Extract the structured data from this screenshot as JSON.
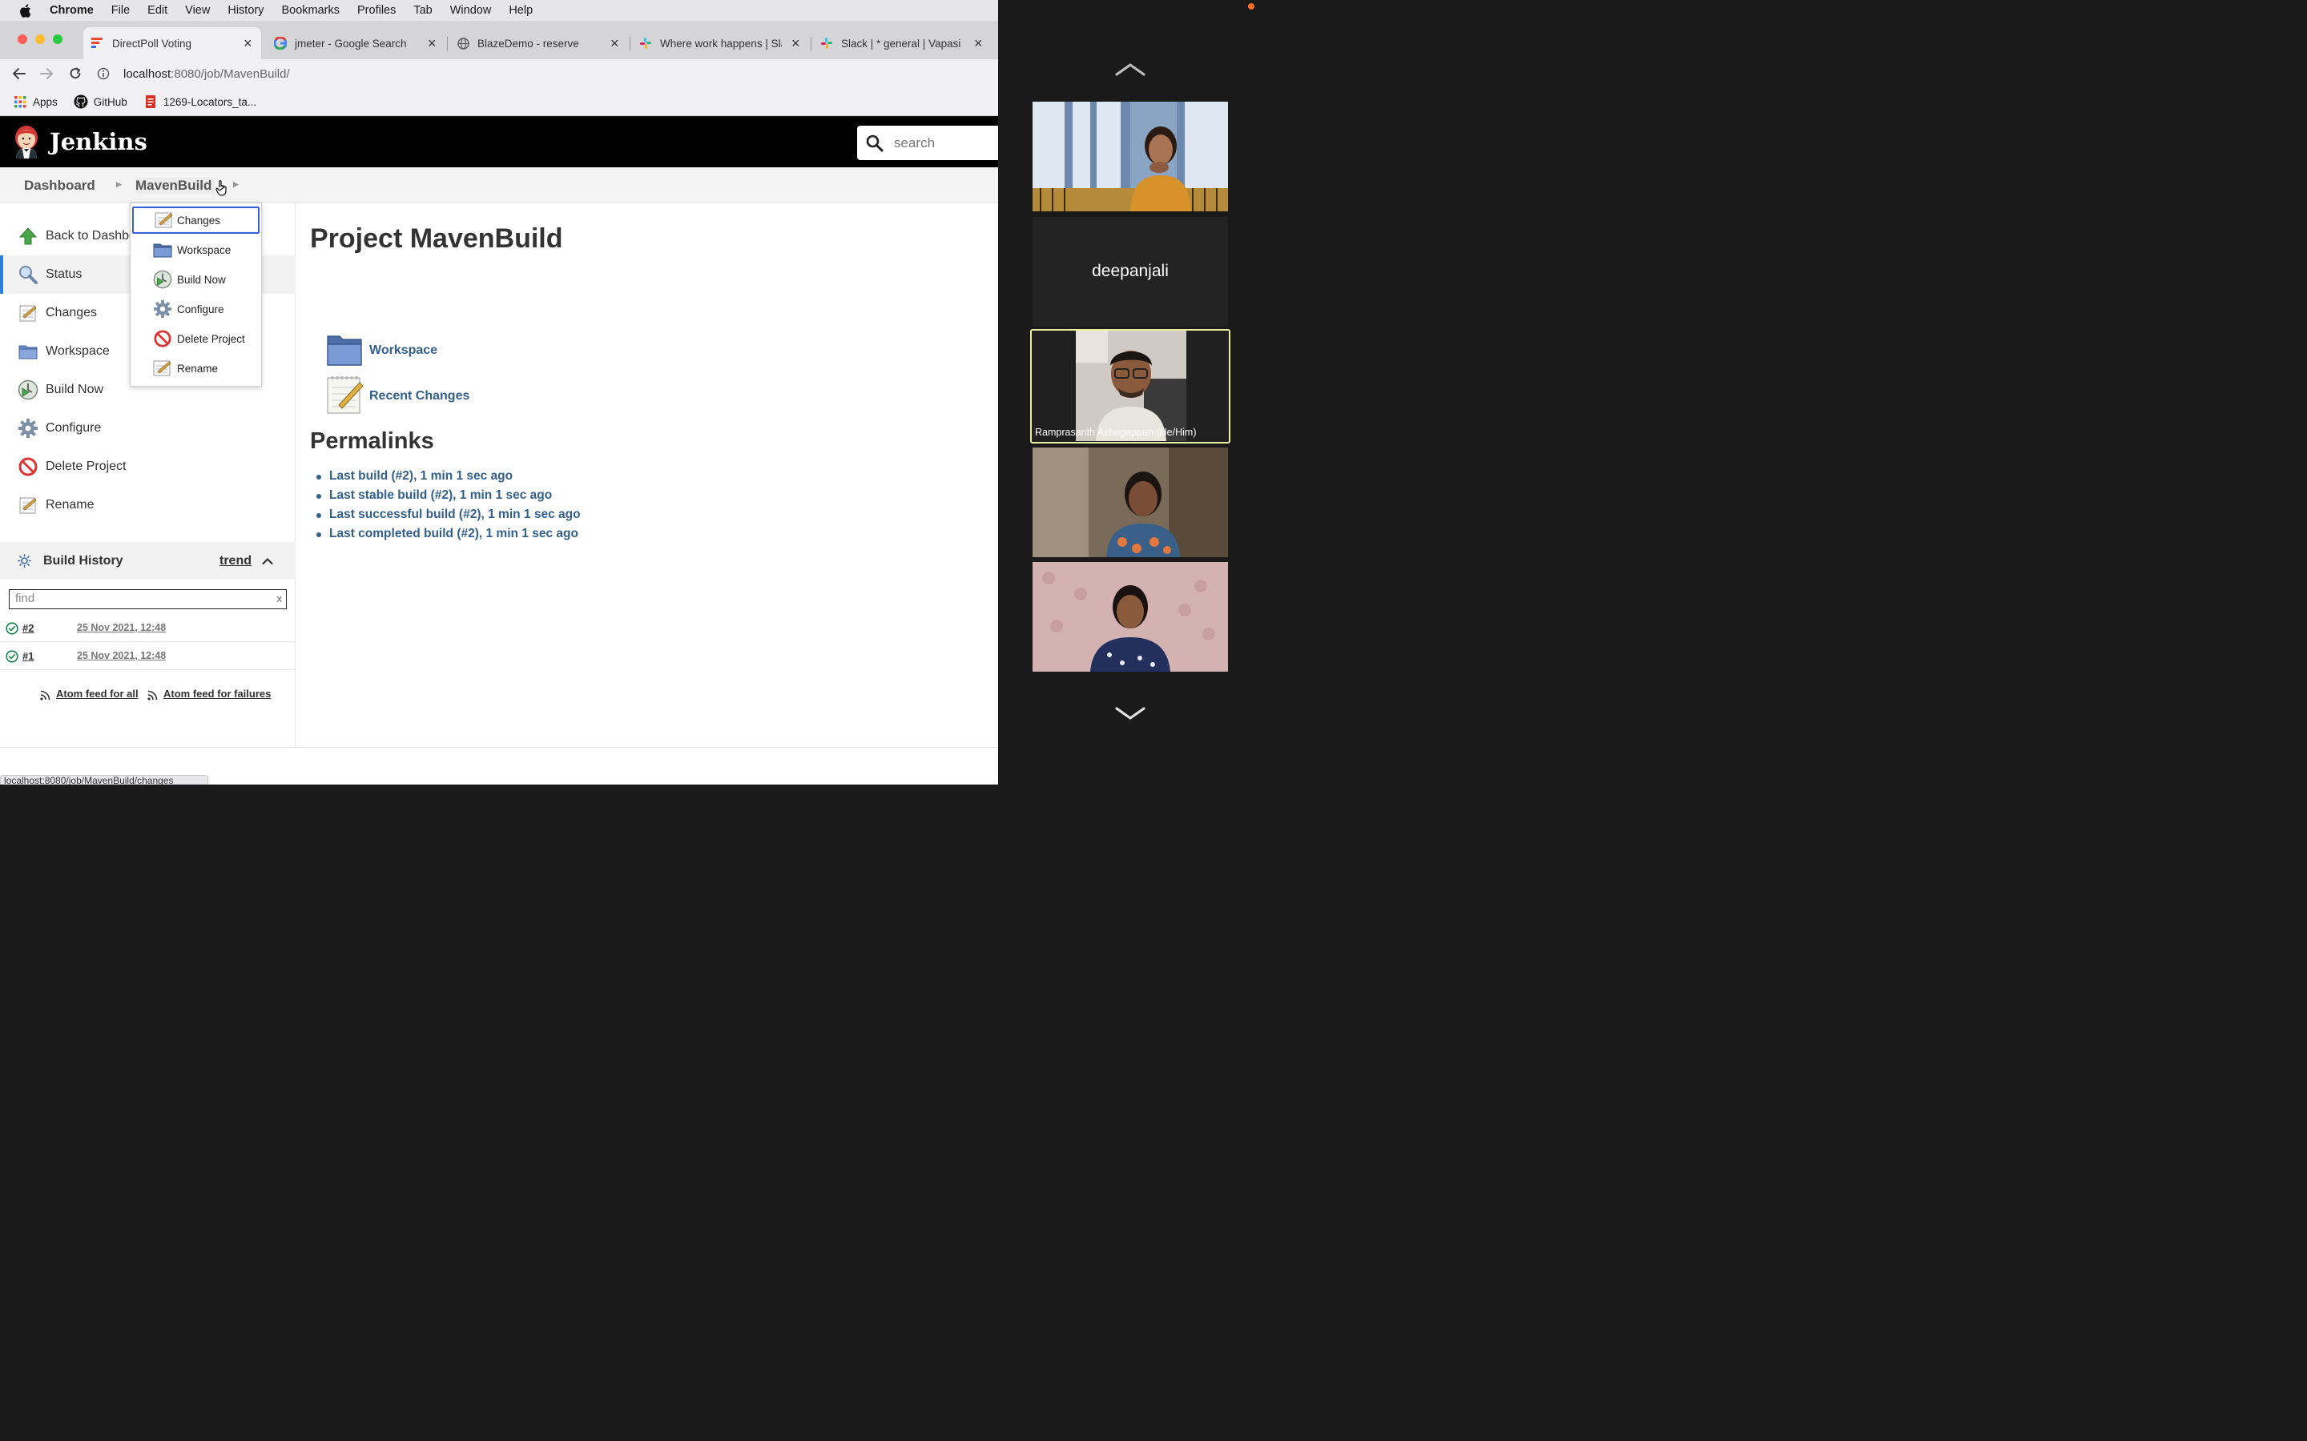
{
  "menubar": {
    "app": "Chrome",
    "items": [
      "File",
      "Edit",
      "View",
      "History",
      "Bookmarks",
      "Profiles",
      "Tab",
      "Window",
      "Help"
    ]
  },
  "tabs": [
    {
      "title": "DirectPoll Voting",
      "icon": "directpoll-icon"
    },
    {
      "title": "jmeter - Google Search",
      "icon": "google-icon"
    },
    {
      "title": "BlazeDemo - reserve",
      "icon": "globe-icon"
    },
    {
      "title": "Where work happens | Sla",
      "icon": "slack-icon"
    },
    {
      "title": "Slack | * general | Vapasi",
      "icon": "slack-icon"
    }
  ],
  "address": {
    "host": "localhost",
    "path": ":8080/job/MavenBuild/"
  },
  "bookmarks": [
    "Apps",
    "GitHub",
    "1269-Locators_ta..."
  ],
  "jenkins": {
    "title": "Jenkins",
    "search_placeholder": "search"
  },
  "breadcrumb": [
    "Dashboard",
    "MavenBuild"
  ],
  "sidebar": {
    "tasks": [
      {
        "label": "Back to Dashboard",
        "icon": "up-arrow-icon"
      },
      {
        "label": "Status",
        "icon": "magnifier-icon"
      },
      {
        "label": "Changes",
        "icon": "notepad-icon"
      },
      {
        "label": "Workspace",
        "icon": "folder-icon"
      },
      {
        "label": "Build Now",
        "icon": "clock-play-icon"
      },
      {
        "label": "Configure",
        "icon": "gear-icon"
      },
      {
        "label": "Delete Project",
        "icon": "no-entry-icon"
      },
      {
        "label": "Rename",
        "icon": "notepad-icon"
      }
    ]
  },
  "build_history": {
    "title": "Build History",
    "trend": "trend",
    "find_placeholder": "find",
    "clear": "x",
    "builds": [
      {
        "num": "#2",
        "date": "25 Nov 2021, 12:48",
        "status": "success"
      },
      {
        "num": "#1",
        "date": "25 Nov 2021, 12:48",
        "status": "success"
      }
    ],
    "atom_all": "Atom feed for all",
    "atom_failures": "Atom feed for failures"
  },
  "dropdown": {
    "items": [
      "Changes",
      "Workspace",
      "Build Now",
      "Configure",
      "Delete Project",
      "Rename"
    ]
  },
  "main": {
    "title": "Project MavenBuild",
    "workspace": "Workspace",
    "recent_changes": "Recent Changes",
    "permalinks_title": "Permalinks",
    "permalinks": [
      "Last build (#2), 1 min 1 sec ago",
      "Last stable build (#2), 1 min 1 sec ago",
      "Last successful build (#2), 1 min 1 sec ago",
      "Last completed build (#2), 1 min 1 sec ago"
    ]
  },
  "statusbar": "localhost:8080/job/MavenBuild/changes",
  "zoom": {
    "participants": [
      {
        "name": "",
        "video": true
      },
      {
        "name": "deepanjali",
        "video": false
      },
      {
        "name": "Ramprasanth Azhagappan (He/Him)",
        "video": true,
        "active": true
      },
      {
        "name": "",
        "video": true
      },
      {
        "name": "",
        "video": true
      }
    ]
  },
  "colors": {
    "jenkins_link": "#335f8c",
    "active_speaker": "#e8f0a0",
    "dropdown_focus": "#3a5ed9"
  }
}
